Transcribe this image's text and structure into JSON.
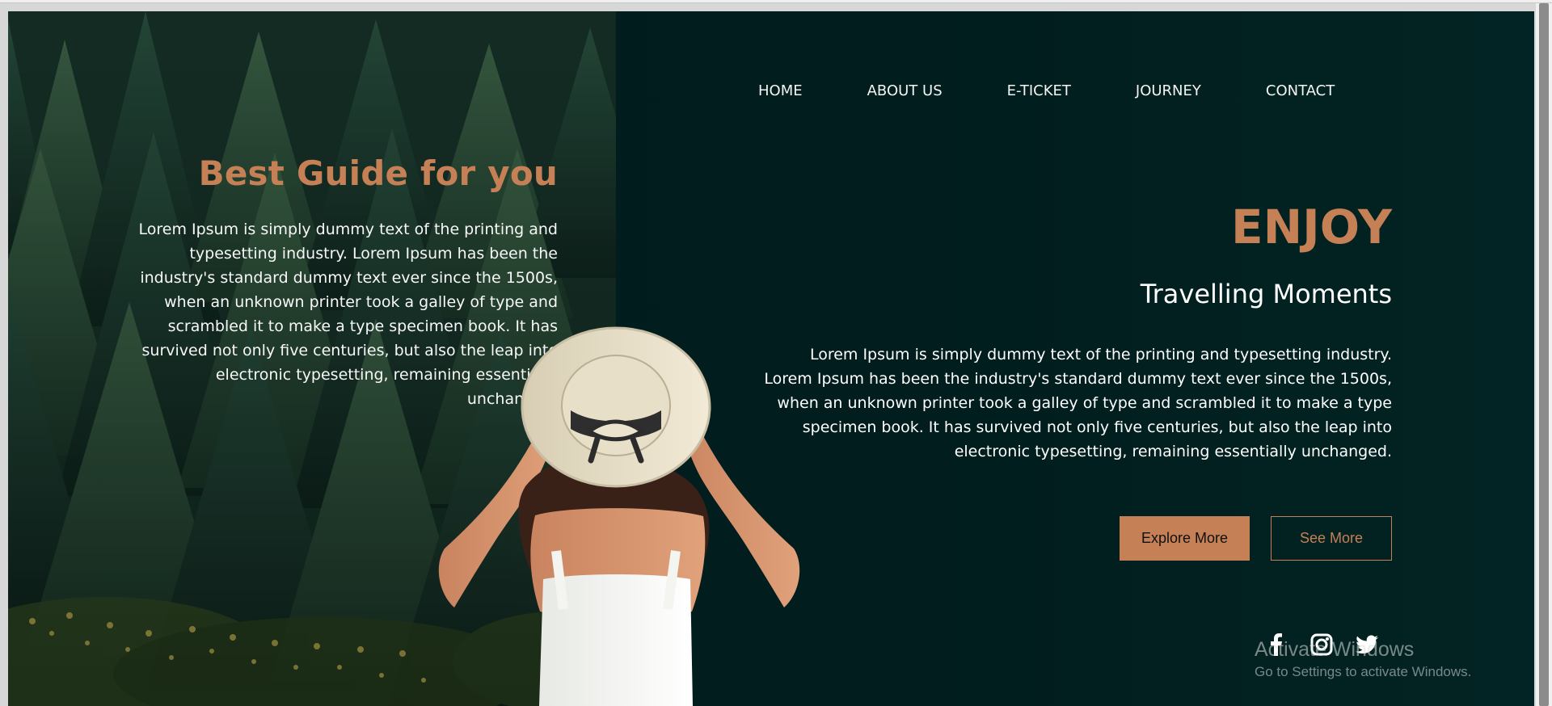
{
  "window": {
    "title": ""
  },
  "navigation": [
    {
      "label": "HOME"
    },
    {
      "label": "ABOUT US"
    },
    {
      "label": "E-TICKET"
    },
    {
      "label": "JOURNEY"
    },
    {
      "label": "CONTACT"
    }
  ],
  "left_panel": {
    "title": "Best Guide for you",
    "text": "Lorem Ipsum is simply dummy text of the printing and typesetting industry. Lorem Ipsum has been the industry's standard dummy text ever since the 1500s, when an unknown printer took a galley of type and scrambled it to make a type specimen book. It has survived not only five centuries, but also the leap into electronic typesetting, remaining essentially unchanged."
  },
  "hero": {
    "headline": "ENJOY",
    "subtitle": "Travelling Moments",
    "text": "Lorem Ipsum is simply dummy text of the printing and typesetting industry. Lorem Ipsum has been the industry's standard dummy text ever since the 1500s, when an unknown printer took a galley of type and scrambled it to make a type specimen book. It has survived not only five centuries, but also the leap into electronic typesetting, remaining essentially unchanged."
  },
  "buttons": {
    "explore": "Explore More",
    "see": "See More"
  },
  "social": [
    "facebook-icon",
    "instagram-icon",
    "twitter-icon"
  ],
  "watermark": {
    "title": "Activate Windows",
    "subtitle": "Go to Settings to activate Windows."
  },
  "colors": {
    "accent": "#c68055",
    "background": "#011d1d",
    "text": "#ffffff"
  }
}
